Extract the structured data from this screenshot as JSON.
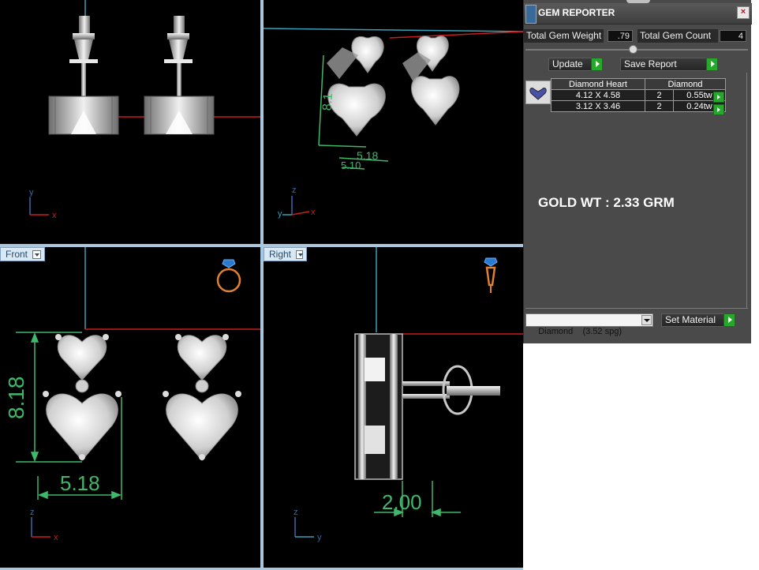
{
  "viewports": {
    "front_label": "Front",
    "right_label": "Right"
  },
  "dimensions": {
    "persp_1": "8.1",
    "persp_2": "5.18",
    "persp_3": "5.10",
    "front_height": "8.18",
    "front_width": "5.18",
    "right_depth": "2.00"
  },
  "axes": {
    "top": {
      "v": "y",
      "h": "x"
    },
    "persp": {
      "v": "z",
      "h": "x",
      "d": "y"
    },
    "front": {
      "v": "z",
      "h": "x"
    },
    "right": {
      "v": "z",
      "h": "y"
    }
  },
  "gem_reporter": {
    "title": "GEM REPORTER",
    "close": "×",
    "total_weight_label": "Total Gem Weight",
    "total_weight_value": ".79",
    "total_count_label": "Total Gem Count",
    "total_count_value": "4",
    "update_button": "Update",
    "save_report_button": "Save Report",
    "table": {
      "headers": [
        "Diamond Heart",
        "Diamond"
      ],
      "rows": [
        {
          "size": "4.12 X 4.58",
          "count": "2",
          "weight": "0.55tw"
        },
        {
          "size": "3.12 X 3.46",
          "count": "2",
          "weight": "0.24tw"
        }
      ]
    },
    "gold_weight": "GOLD WT : 2.33 GRM",
    "material_select": "Diamond    (3.52 spg)",
    "set_material_button": "Set Material"
  },
  "colors": {
    "dimension": "#3fb86a",
    "axis_red": "#c81e1e",
    "axis_cyan": "#3aa0b8",
    "metal": "#c8c8c8",
    "go_green": "#27a82c"
  }
}
